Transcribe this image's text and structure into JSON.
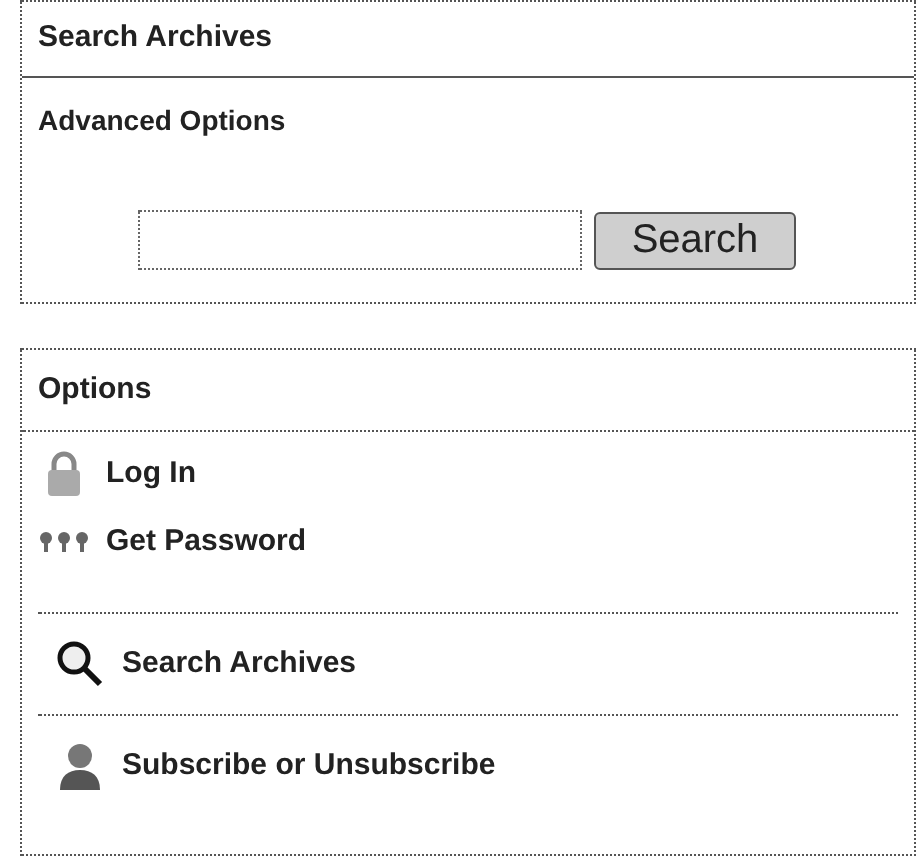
{
  "search_panel": {
    "title": "Search Archives",
    "advanced_link": "Advanced Options",
    "button": "Search"
  },
  "options_panel": {
    "title": "Options",
    "groups": [
      [
        {
          "kind": "lock",
          "label": "Log In"
        },
        {
          "kind": "keys",
          "label": "Get Password"
        }
      ],
      [
        {
          "kind": "magnifier",
          "label": "Search Archives"
        }
      ],
      [
        {
          "kind": "person",
          "label": "Subscribe or Unsubscribe"
        }
      ]
    ]
  }
}
